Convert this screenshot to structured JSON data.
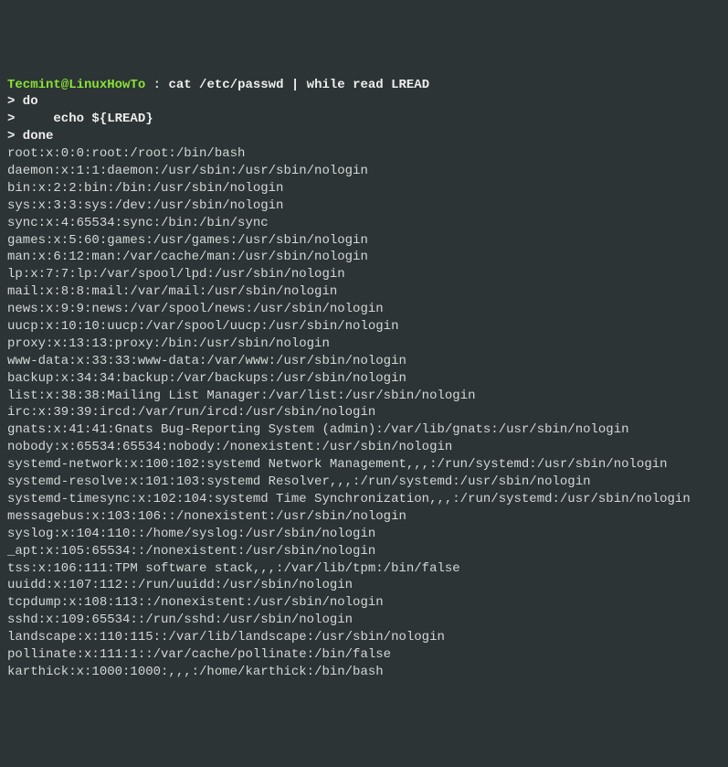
{
  "prompt": {
    "user_host": "Tecmint@LinuxHowTo",
    "separator": " : ",
    "command": "cat /etc/passwd | while read LREAD"
  },
  "continuation": [
    "> do",
    ">     echo ${LREAD}",
    "> done"
  ],
  "output": [
    "root:x:0:0:root:/root:/bin/bash",
    "daemon:x:1:1:daemon:/usr/sbin:/usr/sbin/nologin",
    "bin:x:2:2:bin:/bin:/usr/sbin/nologin",
    "sys:x:3:3:sys:/dev:/usr/sbin/nologin",
    "sync:x:4:65534:sync:/bin:/bin/sync",
    "games:x:5:60:games:/usr/games:/usr/sbin/nologin",
    "man:x:6:12:man:/var/cache/man:/usr/sbin/nologin",
    "lp:x:7:7:lp:/var/spool/lpd:/usr/sbin/nologin",
    "mail:x:8:8:mail:/var/mail:/usr/sbin/nologin",
    "news:x:9:9:news:/var/spool/news:/usr/sbin/nologin",
    "uucp:x:10:10:uucp:/var/spool/uucp:/usr/sbin/nologin",
    "proxy:x:13:13:proxy:/bin:/usr/sbin/nologin",
    "www-data:x:33:33:www-data:/var/www:/usr/sbin/nologin",
    "backup:x:34:34:backup:/var/backups:/usr/sbin/nologin",
    "list:x:38:38:Mailing List Manager:/var/list:/usr/sbin/nologin",
    "irc:x:39:39:ircd:/var/run/ircd:/usr/sbin/nologin",
    "gnats:x:41:41:Gnats Bug-Reporting System (admin):/var/lib/gnats:/usr/sbin/nologin",
    "nobody:x:65534:65534:nobody:/nonexistent:/usr/sbin/nologin",
    "systemd-network:x:100:102:systemd Network Management,,,:/run/systemd:/usr/sbin/nologin",
    "systemd-resolve:x:101:103:systemd Resolver,,,:/run/systemd:/usr/sbin/nologin",
    "systemd-timesync:x:102:104:systemd Time Synchronization,,,:/run/systemd:/usr/sbin/nologin",
    "messagebus:x:103:106::/nonexistent:/usr/sbin/nologin",
    "syslog:x:104:110::/home/syslog:/usr/sbin/nologin",
    "_apt:x:105:65534::/nonexistent:/usr/sbin/nologin",
    "tss:x:106:111:TPM software stack,,,:/var/lib/tpm:/bin/false",
    "uuidd:x:107:112::/run/uuidd:/usr/sbin/nologin",
    "tcpdump:x:108:113::/nonexistent:/usr/sbin/nologin",
    "sshd:x:109:65534::/run/sshd:/usr/sbin/nologin",
    "landscape:x:110:115::/var/lib/landscape:/usr/sbin/nologin",
    "pollinate:x:111:1::/var/cache/pollinate:/bin/false",
    "karthick:x:1000:1000:,,,:/home/karthick:/bin/bash"
  ]
}
